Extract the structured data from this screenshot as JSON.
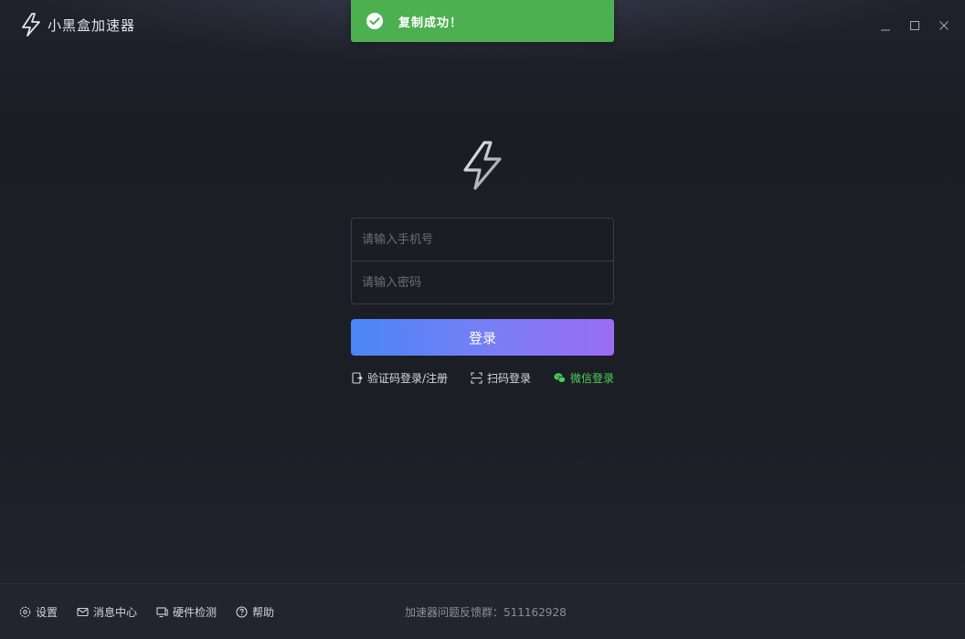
{
  "app": {
    "name": "小黑盒加速器",
    "logo_icon": "lightning-logo-icon"
  },
  "window_controls": {
    "minimize_icon": "minimize-icon",
    "maximize_icon": "maximize-icon",
    "close_icon": "close-icon"
  },
  "toast": {
    "text": "复制成功！",
    "icon": "check-circle-icon",
    "color": "#4caf50"
  },
  "login": {
    "phone_placeholder": "请输入手机号",
    "password_placeholder": "请输入密码",
    "submit_label": "登录",
    "gradient_start": "#4a86f7",
    "gradient_end": "#9a6cf2",
    "alt_methods": [
      {
        "label": "验证码登录/注册",
        "icon": "sms-code-icon"
      },
      {
        "label": "扫码登录",
        "icon": "scan-icon"
      },
      {
        "label": "微信登录",
        "icon": "wechat-icon",
        "color": "#4fcf5a"
      }
    ]
  },
  "footer": {
    "items": [
      {
        "label": "设置",
        "icon": "gear-icon"
      },
      {
        "label": "消息中心",
        "icon": "mail-icon"
      },
      {
        "label": "硬件检测",
        "icon": "monitor-icon"
      },
      {
        "label": "帮助",
        "icon": "help-icon"
      }
    ],
    "feedback_text": "加速器问题反馈群：511162928"
  }
}
